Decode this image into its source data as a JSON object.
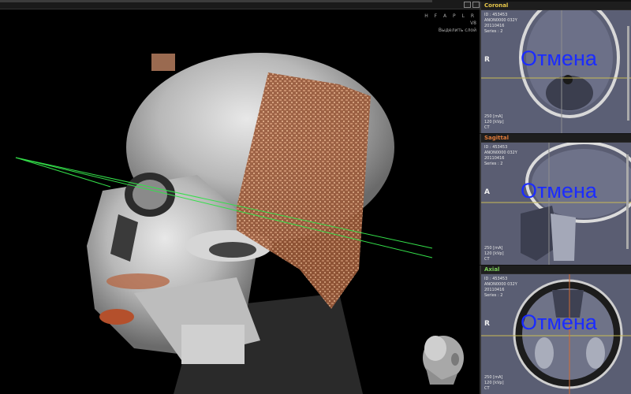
{
  "overlay_3d": {
    "orientation": "H F A P L R",
    "line2": "V8",
    "line3": "Выделить слой"
  },
  "panels": {
    "coronal": {
      "title": "Coronal",
      "title_color": "#e8c84a",
      "id_line": "ID : 453453",
      "acc_line": "ANON0000 032Y",
      "date_line": "20110416",
      "series_line": "Series : 2",
      "orient": "R",
      "ma_line": "250 [mA]",
      "kv_line": "120 [kVp]",
      "ct_line": "CT",
      "overlay_text": "Отмена"
    },
    "sagittal": {
      "title": "Sagittal",
      "title_color": "#e07a3a",
      "id_line": "ID : 453453",
      "acc_line": "ANON0000 032Y",
      "date_line": "20110416",
      "series_line": "Series : 2",
      "orient": "A",
      "ma_line": "250 [mA]",
      "kv_line": "120 [kVp]",
      "ct_line": "CT",
      "overlay_text": "Отмена"
    },
    "axial": {
      "title": "Axial",
      "title_color": "#7ccf5a",
      "id_line": "ID : 453453",
      "acc_line": "ANON0000 032Y",
      "date_line": "20110416",
      "series_line": "Series : 2",
      "orient": "R",
      "ma_line": "250 [mA]",
      "kv_line": "120 [kVp]",
      "ct_line": "CT",
      "overlay_text": "Отмена"
    }
  },
  "icons": {
    "window_restore": "window-restore-icon",
    "window_close": "window-close-icon",
    "orientation_head": "head-orientation-icon"
  }
}
